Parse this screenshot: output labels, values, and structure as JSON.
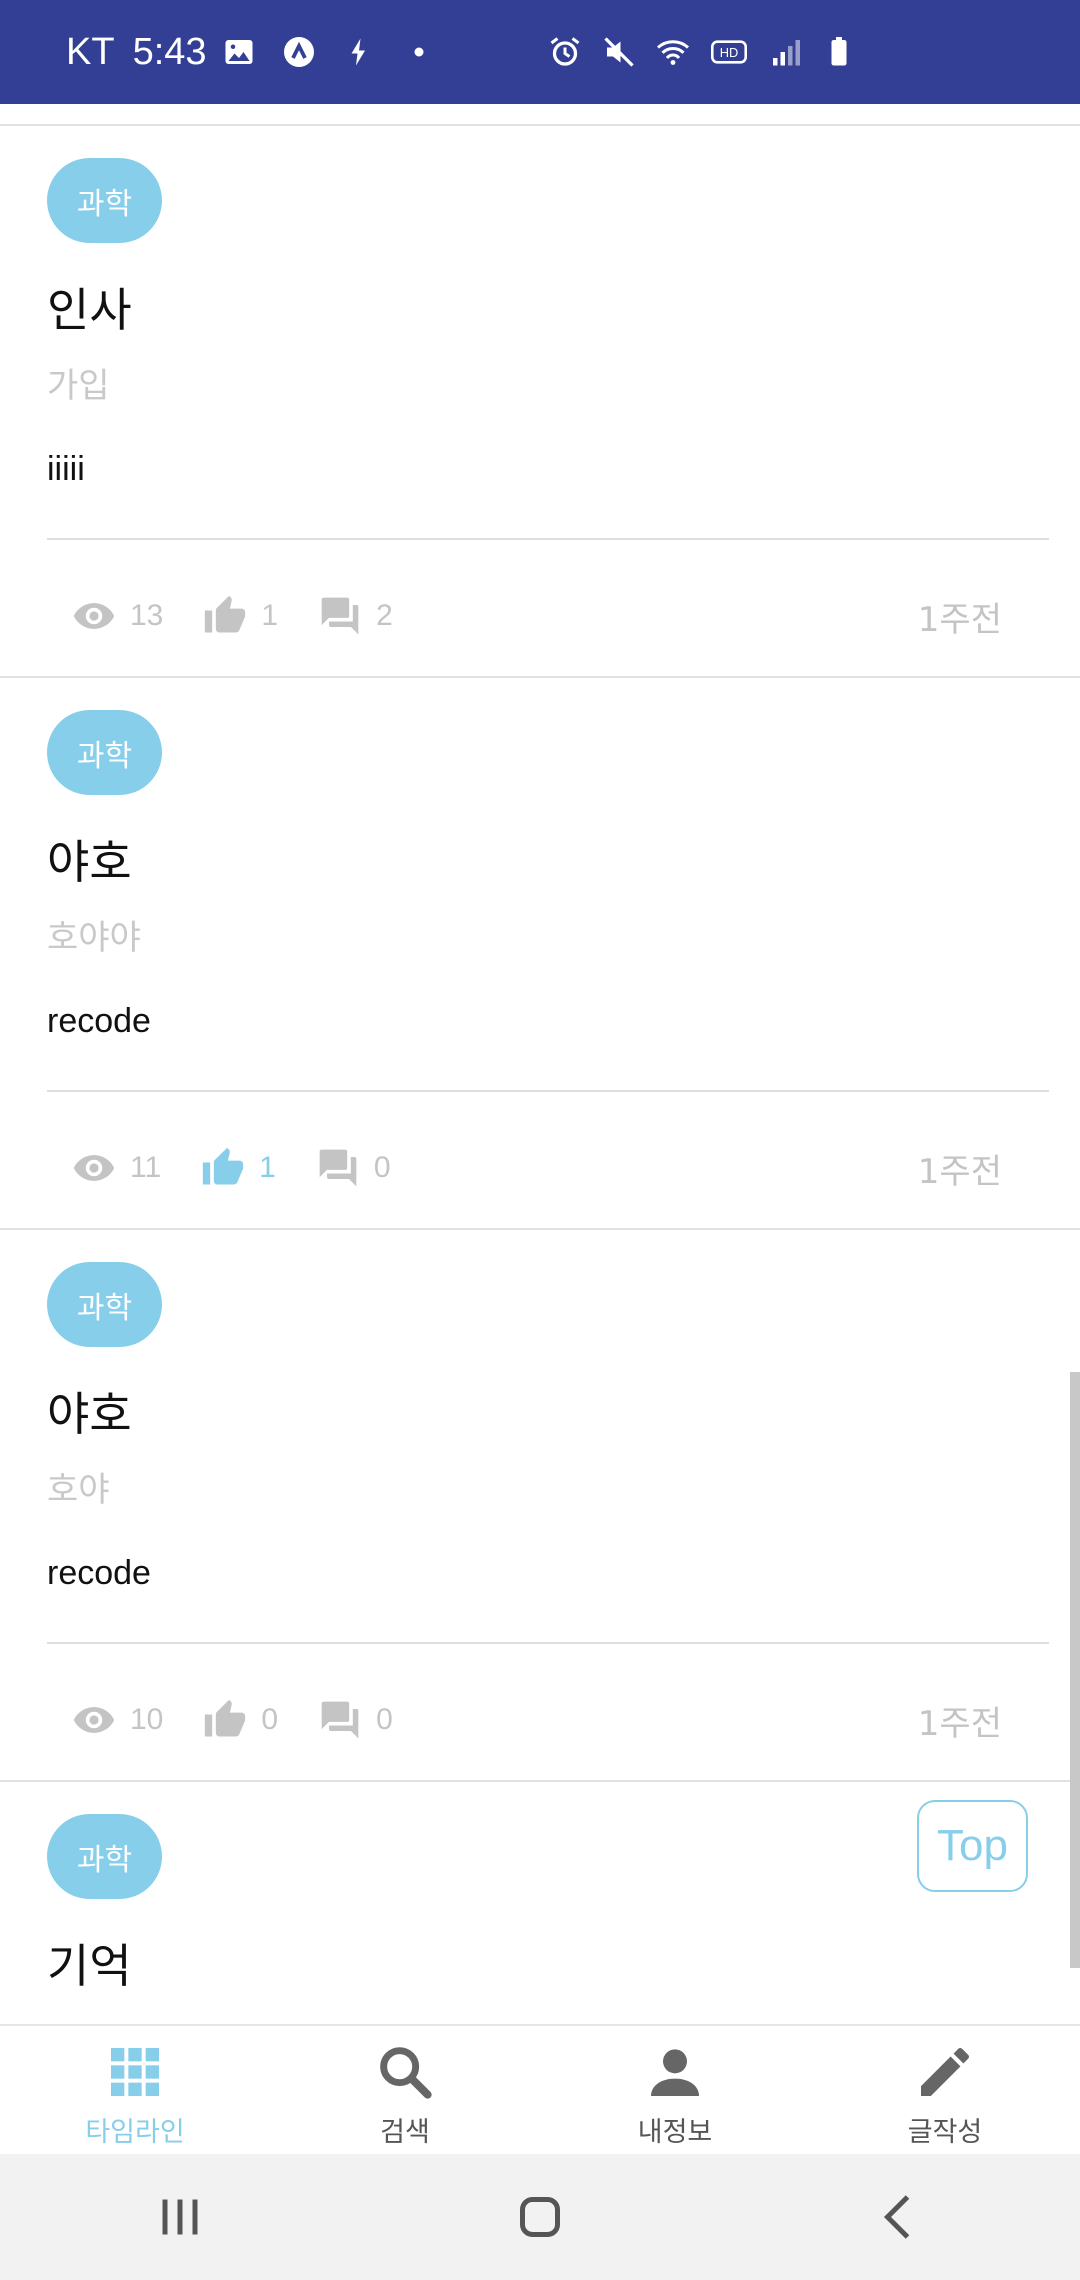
{
  "status_bar": {
    "carrier": "KT",
    "time": "5:43",
    "hd_label": "HD"
  },
  "posts": [
    {
      "category": "과학",
      "title": "인사",
      "subtitle": "가입",
      "body": "iiiii",
      "views": "13",
      "likes": "1",
      "comments": "2",
      "time_ago": "1주전",
      "liked": false
    },
    {
      "category": "과학",
      "title": "야호",
      "subtitle": "호야야",
      "body": "recode",
      "views": "11",
      "likes": "1",
      "comments": "0",
      "time_ago": "1주전",
      "liked": true
    },
    {
      "category": "과학",
      "title": "야호",
      "subtitle": "호야",
      "body": "recode",
      "views": "10",
      "likes": "0",
      "comments": "0",
      "time_ago": "1주전",
      "liked": false
    },
    {
      "category": "과학",
      "title": "기억",
      "subtitle": ""
    }
  ],
  "top_button": "Top",
  "bottom_nav": [
    {
      "label": "타임라인",
      "icon": "grid-icon",
      "active": true
    },
    {
      "label": "검색",
      "icon": "search-icon",
      "active": false
    },
    {
      "label": "내정보",
      "icon": "person-icon",
      "active": false
    },
    {
      "label": "글작성",
      "icon": "pencil-icon",
      "active": false
    }
  ],
  "colors": {
    "status_bar": "#333f95",
    "accent": "#87ceeb",
    "muted": "#c4c4c4"
  }
}
